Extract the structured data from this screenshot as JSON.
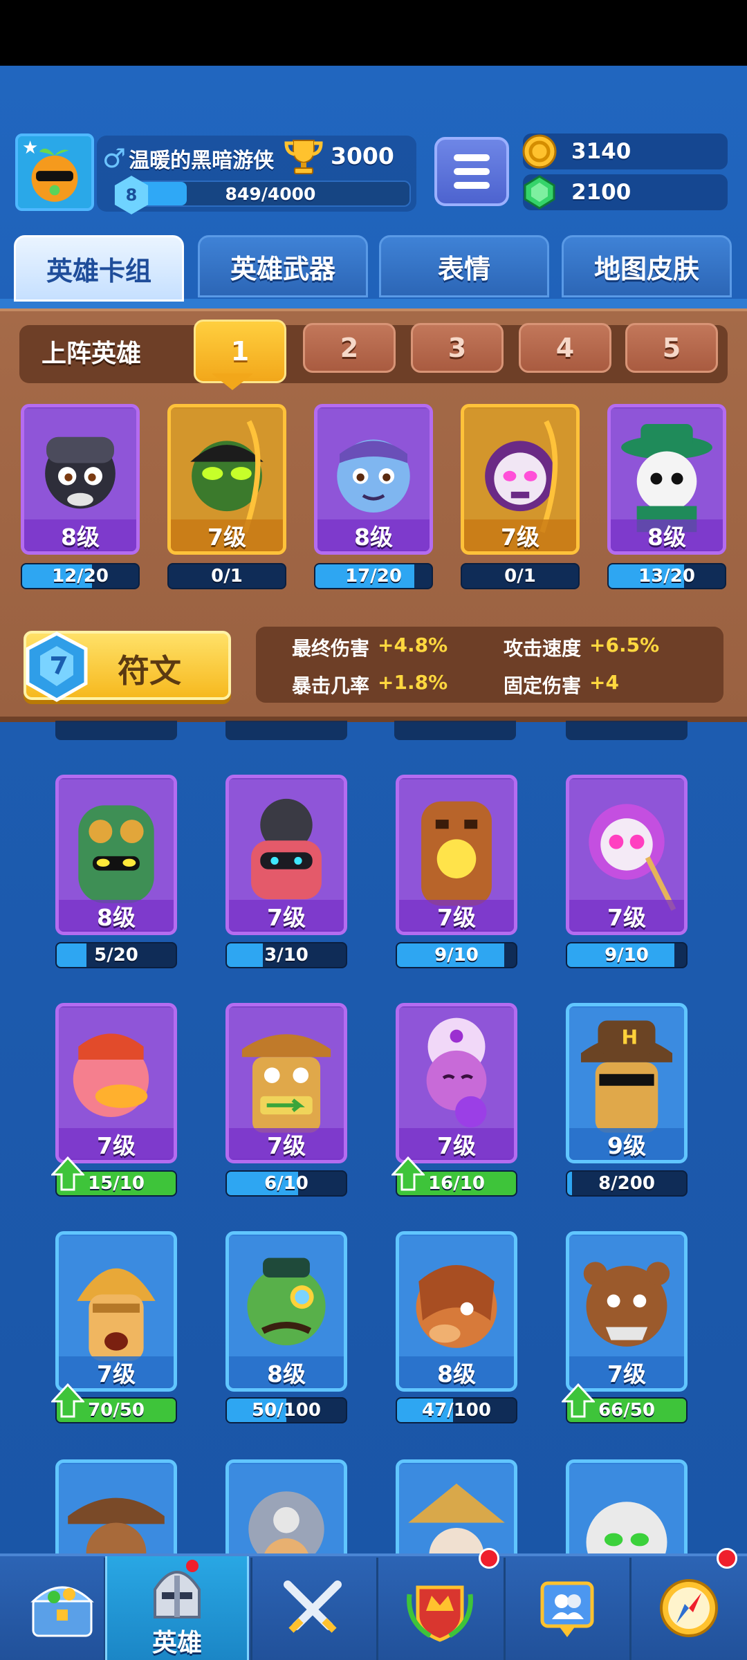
{
  "player": {
    "name": "温暖的黑暗游侠",
    "trophies": "3000",
    "level": "8",
    "xp_text": "849/4000",
    "xp_fraction": 0.2
  },
  "currency": {
    "gold": "3140",
    "gems": "2100"
  },
  "tabs": [
    "英雄卡组",
    "英雄武器",
    "表情",
    "地图皮肤"
  ],
  "deck": {
    "label": "上阵英雄",
    "slots": [
      "1",
      "2",
      "3",
      "4",
      "5"
    ],
    "heroes": [
      {
        "level": "8级",
        "progress": "12/20",
        "fraction": 0.6
      },
      {
        "level": "7级",
        "progress": "0/1",
        "fraction": 0
      },
      {
        "level": "8级",
        "progress": "17/20",
        "fraction": 0.85
      },
      {
        "level": "7级",
        "progress": "0/1",
        "fraction": 0
      },
      {
        "level": "8级",
        "progress": "13/20",
        "fraction": 0.65
      }
    ]
  },
  "rune": {
    "label": "符文",
    "stats": [
      {
        "name": "最终伤害",
        "value": "+4.8%"
      },
      {
        "name": "攻击速度",
        "value": "+6.5%"
      },
      {
        "name": "暴击几率",
        "value": "+1.8%"
      },
      {
        "name": "固定伤害",
        "value": "+4"
      }
    ]
  },
  "collection": [
    {
      "level": "8级",
      "progress": "5/20",
      "fraction": 0.25
    },
    {
      "level": "7级",
      "progress": "3/10",
      "fraction": 0.3
    },
    {
      "level": "7级",
      "progress": "9/10",
      "fraction": 0.9
    },
    {
      "level": "7级",
      "progress": "9/10",
      "fraction": 0.9
    },
    {
      "level": "7级",
      "progress": "15/10",
      "fraction": 1.0
    },
    {
      "level": "7级",
      "progress": "6/10",
      "fraction": 0.6
    },
    {
      "level": "7级",
      "progress": "16/10",
      "fraction": 1.0
    },
    {
      "level": "9级",
      "progress": "8/200",
      "fraction": 0.04
    },
    {
      "level": "7级",
      "progress": "70/50",
      "fraction": 1.0
    },
    {
      "level": "8级",
      "progress": "50/100",
      "fraction": 0.5
    },
    {
      "level": "8级",
      "progress": "47/100",
      "fraction": 0.47
    },
    {
      "level": "7级",
      "progress": "66/50",
      "fraction": 1.0
    }
  ],
  "nav": {
    "hero_label": "英雄"
  },
  "colors": {
    "accent_gold": "#f6b91f",
    "panel_wood": "#a56a48",
    "epic_purple": "#b46cf0",
    "rare_blue": "#61c6ff",
    "upgrade_green": "#3ec43a"
  }
}
